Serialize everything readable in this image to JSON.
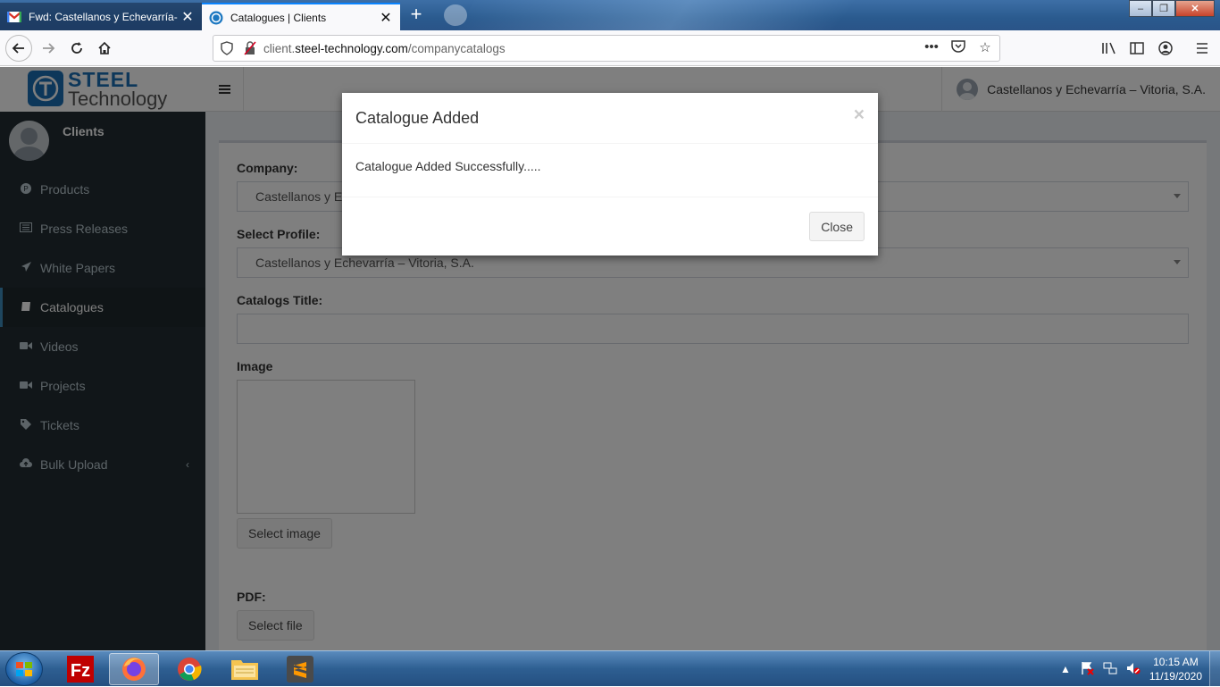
{
  "browser": {
    "tabs": [
      {
        "title": "Fwd: Castellanos y Echevarría- V",
        "active": false
      },
      {
        "title": "Catalogues | Clients",
        "active": true
      }
    ],
    "url_prefix": "client.",
    "url_domain": "steel-technology.com",
    "url_path": "/companycatalogs",
    "window_controls": {
      "minimize": "‒",
      "maximize": "❐",
      "close": "✕"
    }
  },
  "app": {
    "logo": {
      "line1": "STEEL",
      "line2": "Technology"
    },
    "header_user": "Castellanos y Echevarría – Vitoria, S.A.",
    "sidebar": {
      "user_label": "Clients",
      "items": [
        {
          "label": "Products",
          "icon": "products-icon"
        },
        {
          "label": "Press Releases",
          "icon": "newspaper-icon"
        },
        {
          "label": "White Papers",
          "icon": "paper-plane-icon"
        },
        {
          "label": "Catalogues",
          "icon": "book-icon",
          "active": true
        },
        {
          "label": "Videos",
          "icon": "video-icon"
        },
        {
          "label": "Projects",
          "icon": "video-icon"
        },
        {
          "label": "Tickets",
          "icon": "tag-icon"
        },
        {
          "label": "Bulk Upload",
          "icon": "cloud-upload-icon",
          "chevron": "‹"
        }
      ]
    },
    "form": {
      "company_label": "Company:",
      "company_value": "Castellanos y E",
      "profile_label": "Select Profile:",
      "profile_value": "Castellanos y Echevarría – Vitoria, S.A.",
      "title_label": "Catalogs Title:",
      "title_value": "",
      "image_label": "Image",
      "select_image_btn": "Select image",
      "pdf_label": "PDF:",
      "select_file_btn": "Select file"
    }
  },
  "modal": {
    "title": "Catalogue Added",
    "close_x": "×",
    "message": "Catalogue Added Successfully.....",
    "close_button": "Close"
  },
  "taskbar": {
    "apps": [
      "filezilla",
      "firefox",
      "chrome",
      "file-explorer",
      "sublime-text"
    ],
    "active_app": "firefox",
    "time": "10:15 AM",
    "date": "11/19/2020"
  },
  "colors": {
    "sidebar_bg": "#222d32",
    "sidebar_text": "#b8c7ce",
    "accent": "#3c8dbc",
    "content_bg": "#ecf0f5"
  }
}
